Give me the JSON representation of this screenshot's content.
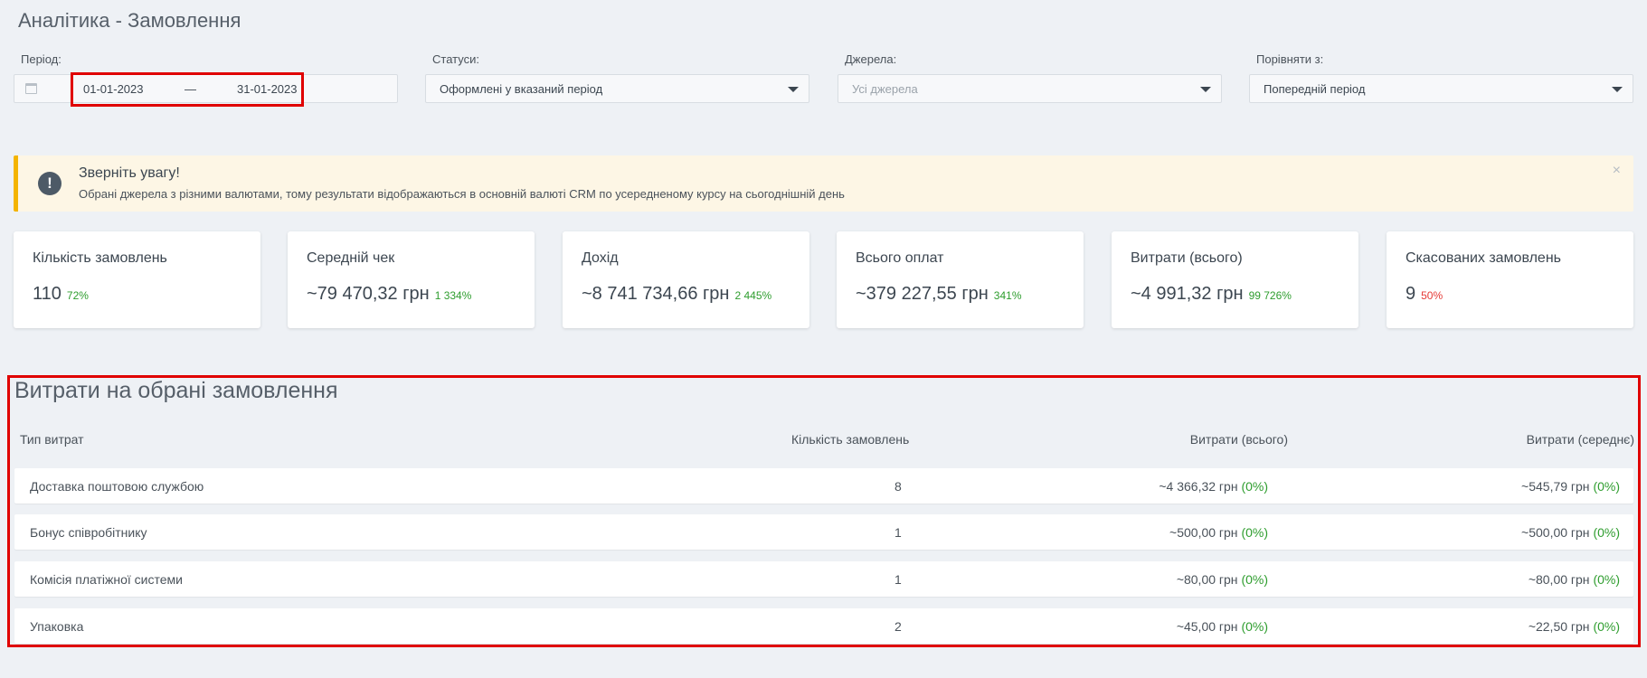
{
  "page_title": "Аналітика - Замовлення",
  "filters": {
    "period": {
      "label": "Період:",
      "from": "01-01-2023",
      "separator": "—",
      "to": "31-01-2023"
    },
    "statuses": {
      "label": "Статуси:",
      "value": "Оформлені у вказаний період"
    },
    "sources": {
      "label": "Джерела:",
      "placeholder": "Усі джерела"
    },
    "compare": {
      "label": "Порівняти з:",
      "value": "Попередній період"
    }
  },
  "alert": {
    "title": "Зверніть увагу!",
    "text": "Обрані джерела з різними валютами, тому результати відображаються в основній валюті CRM по усередненому курсу на сьогоднішній день",
    "icon": "!",
    "close": "×"
  },
  "kpis": [
    {
      "label": "Кількість замовлень",
      "value": "110",
      "pct": "72%",
      "status": "up"
    },
    {
      "label": "Середній чек",
      "value": "~79 470,32 грн",
      "pct": "1 334%",
      "status": "up"
    },
    {
      "label": "Дохід",
      "value": "~8 741 734,66 грн",
      "pct": "2 445%",
      "status": "up"
    },
    {
      "label": "Всього оплат",
      "value": "~379 227,55 грн",
      "pct": "341%",
      "status": "up"
    },
    {
      "label": "Витрати (всього)",
      "value": "~4 991,32 грн",
      "pct": "99 726%",
      "status": "up"
    },
    {
      "label": "Скасованих замовлень",
      "value": "9",
      "pct": "50%",
      "status": "down"
    }
  ],
  "expenses": {
    "title": "Витрати на обрані замовлення",
    "headers": {
      "type": "Тип витрат",
      "count": "Кількість замовлень",
      "total": "Витрати (всього)",
      "avg": "Витрати (середнє)"
    },
    "rows": [
      {
        "type": "Доставка поштовою службою",
        "count": "8",
        "total": "~4 366,32 грн",
        "total_pct": "(0%)",
        "avg": "~545,79 грн",
        "avg_pct": "(0%)"
      },
      {
        "type": "Бонус співробітнику",
        "count": "1",
        "total": "~500,00 грн",
        "total_pct": "(0%)",
        "avg": "~500,00 грн",
        "avg_pct": "(0%)"
      },
      {
        "type": "Комісія платіжної системи",
        "count": "1",
        "total": "~80,00 грн",
        "total_pct": "(0%)",
        "avg": "~80,00 грн",
        "avg_pct": "(0%)"
      },
      {
        "type": "Упаковка",
        "count": "2",
        "total": "~45,00 грн",
        "total_pct": "(0%)",
        "avg": "~22,50 грн",
        "avg_pct": "(0%)"
      }
    ]
  },
  "colors": {
    "positive": "#2e9d2e",
    "negative": "#e53935",
    "alert_accent": "#f4b400",
    "highlight": "#e00000"
  }
}
